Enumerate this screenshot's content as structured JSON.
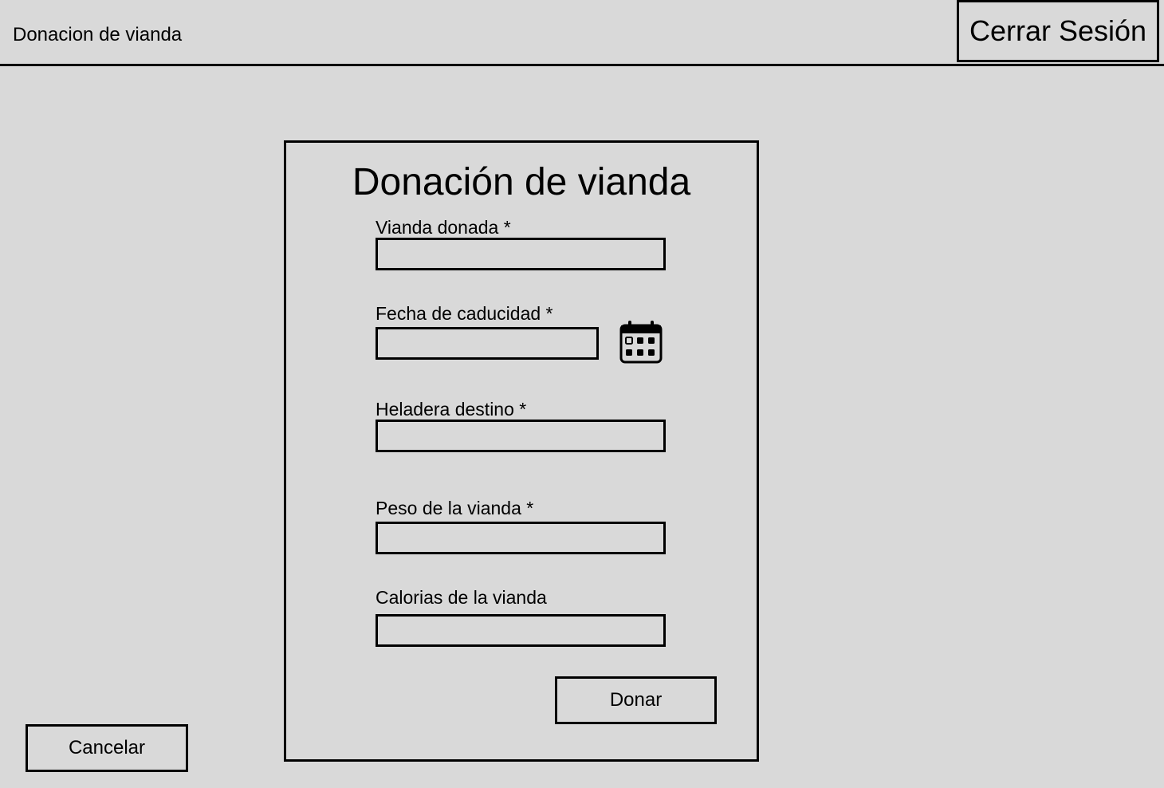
{
  "header": {
    "title": "Donacion de vianda",
    "logout_label": "Cerrar Sesión"
  },
  "form": {
    "title": "Donación de vianda",
    "fields": [
      {
        "label": "Vianda donada *",
        "value": ""
      },
      {
        "label": "Fecha de caducidad *",
        "value": ""
      },
      {
        "label": "Heladera destino *",
        "value": ""
      },
      {
        "label": "Peso de la vianda *",
        "value": ""
      },
      {
        "label": "Calorias de la vianda",
        "value": ""
      }
    ],
    "calendar_icon": "calendar-icon",
    "submit_label": "Donar"
  },
  "footer": {
    "cancel_label": "Cancelar"
  }
}
